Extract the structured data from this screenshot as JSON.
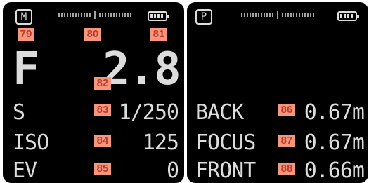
{
  "left_panel": {
    "mode": "M",
    "aperture_label": "F",
    "aperture_value": "2.8",
    "rows": [
      {
        "label": "S",
        "value": "1/250"
      },
      {
        "label": "ISO",
        "value": "125"
      },
      {
        "label": "EV",
        "value": "0"
      }
    ],
    "tags": {
      "mode": "79",
      "level": "80",
      "battery": "81",
      "aperture": "82",
      "shutter": "83",
      "iso": "84",
      "ev": "85"
    }
  },
  "right_panel": {
    "mode": "P",
    "rows": [
      {
        "label": "BACK",
        "value": "0.67m"
      },
      {
        "label": "FOCUS",
        "value": "0.67m"
      },
      {
        "label": "FRONT",
        "value": "0.66m"
      }
    ],
    "tags": {
      "back": "86",
      "focus": "87",
      "front": "88"
    }
  },
  "colors": {
    "screen_bg": "#000000",
    "lcd_text": "#dcdcdc",
    "tag_bg": "#f3977d",
    "tag_text": "#c0392b"
  }
}
